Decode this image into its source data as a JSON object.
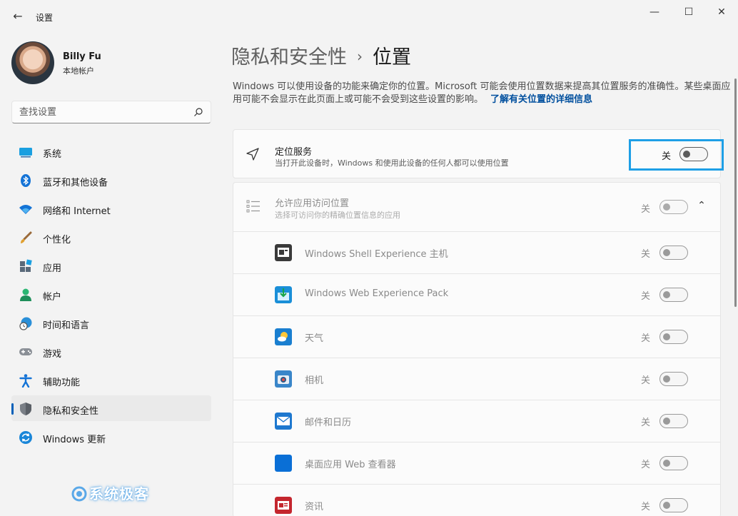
{
  "window": {
    "title": "设置",
    "back_glyph": "←",
    "minimize": "—",
    "maximize": "☐",
    "close": "✕"
  },
  "profile": {
    "name": "Billy Fu",
    "account_type": "本地帐户"
  },
  "search": {
    "placeholder": "查找设置"
  },
  "nav": {
    "items": [
      {
        "label": "系统",
        "icon": "system-icon"
      },
      {
        "label": "蓝牙和其他设备",
        "icon": "bluetooth-icon"
      },
      {
        "label": "网络和 Internet",
        "icon": "wifi-icon"
      },
      {
        "label": "个性化",
        "icon": "brush-icon"
      },
      {
        "label": "应用",
        "icon": "apps-icon"
      },
      {
        "label": "帐户",
        "icon": "person-icon"
      },
      {
        "label": "时间和语言",
        "icon": "globe-clock-icon"
      },
      {
        "label": "游戏",
        "icon": "gamepad-icon"
      },
      {
        "label": "辅助功能",
        "icon": "accessibility-icon"
      },
      {
        "label": "隐私和安全性",
        "icon": "shield-icon",
        "active": true
      },
      {
        "label": "Windows 更新",
        "icon": "update-icon"
      }
    ]
  },
  "page": {
    "breadcrumb_parent": "隐私和安全性",
    "breadcrumb_sep": "›",
    "title": "位置",
    "description": "Windows 可以使用设备的功能来确定你的位置。Microsoft 可能会使用位置数据来提高其位置服务的准确性。某些桌面应用可能不会显示在此页面上或可能不会受到这些设置的影响。",
    "learn_more": "了解有关位置的详细信息"
  },
  "location_service": {
    "title": "定位服务",
    "subtitle": "当打开此设备时，Windows 和使用此设备的任何人都可以使用位置",
    "state": "关",
    "on": false
  },
  "app_access": {
    "title": "允许应用访问位置",
    "subtitle": "选择可访问你的精确位置信息的应用",
    "state": "关",
    "on": false,
    "expand_glyph": "⌃"
  },
  "apps": [
    {
      "name": "Windows Shell Experience 主机",
      "state": "关",
      "icon": "shell-experience-icon",
      "color": "#3a3a3a"
    },
    {
      "name": "Windows Web Experience Pack",
      "state": "关",
      "icon": "web-experience-icon",
      "color": "#1a8fd8"
    },
    {
      "name": "天气",
      "state": "关",
      "icon": "weather-icon",
      "color": "#1a7fd0"
    },
    {
      "name": "相机",
      "state": "关",
      "icon": "camera-icon",
      "color": "#3a86c9"
    },
    {
      "name": "邮件和日历",
      "state": "关",
      "icon": "mail-icon",
      "color": "#1e78cf"
    },
    {
      "name": "桌面应用 Web 查看器",
      "state": "关",
      "icon": "web-viewer-icon",
      "color": "#0a6fd6"
    },
    {
      "name": "资讯",
      "state": "关",
      "icon": "news-icon",
      "color": "#c4262e"
    }
  ],
  "watermark": "系统极客",
  "colors": {
    "accent": "#005fb8",
    "highlight": "#1e9fe6"
  }
}
